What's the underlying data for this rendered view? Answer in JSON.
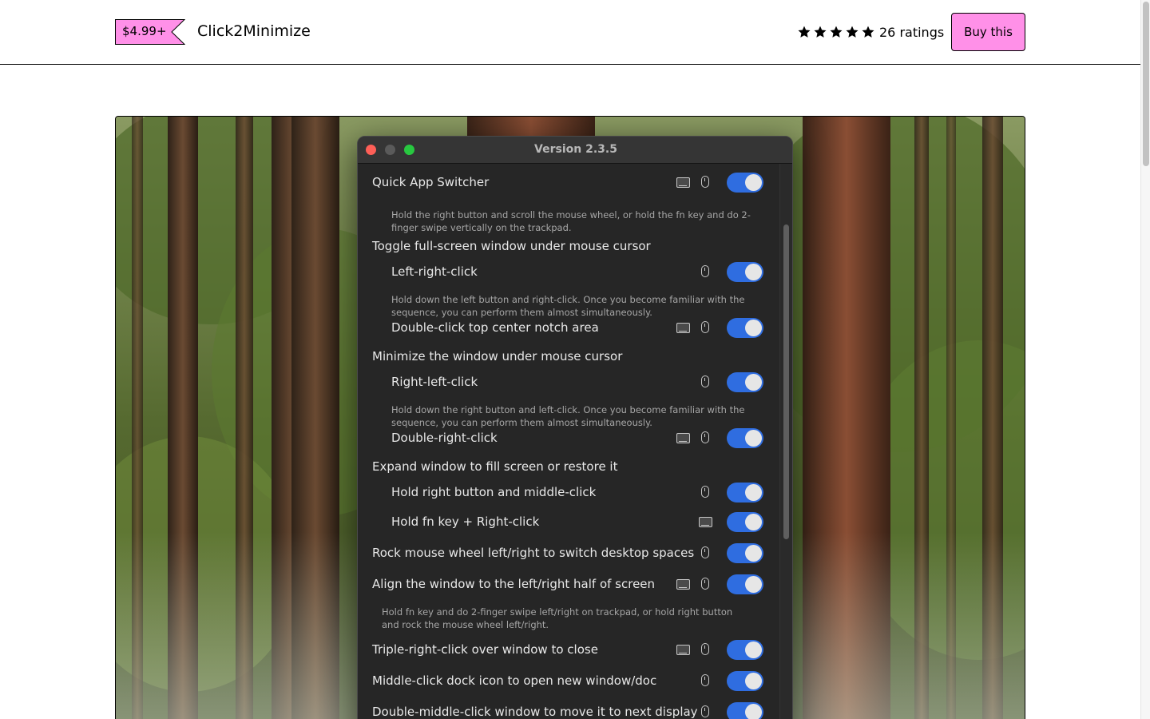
{
  "header": {
    "price": "$4.99+",
    "product_name": "Click2Minimize",
    "rating_stars": 5,
    "ratings_label": "26 ratings",
    "buy_label": "Buy this"
  },
  "colors": {
    "brand_pink": "#ff90e8",
    "toggle_blue": "#2f6de0"
  },
  "app_window": {
    "title": "Version 2.3.5",
    "rows": [
      {
        "type": "setting",
        "label": "Quick App Switcher",
        "icons": [
          "trackpad-icon",
          "mouse-icon"
        ],
        "enabled": true
      },
      {
        "type": "description",
        "text": "Hold the right button and scroll the mouse wheel, or hold the fn key and do 2-finger swipe vertically on the trackpad."
      },
      {
        "type": "heading",
        "label": "Toggle full-screen window under mouse cursor"
      },
      {
        "type": "setting",
        "label": "Left-right-click",
        "icons": [
          "mouse-icon"
        ],
        "enabled": true
      },
      {
        "type": "description",
        "text": "Hold down the left button and right-click. Once you become familiar with the sequence, you can perform them almost simultaneously."
      },
      {
        "type": "setting",
        "label": "Double-click top center notch area",
        "icons": [
          "trackpad-icon",
          "mouse-icon"
        ],
        "enabled": true
      },
      {
        "type": "heading",
        "label": "Minimize the window under mouse cursor"
      },
      {
        "type": "setting",
        "label": "Right-left-click",
        "icons": [
          "mouse-icon"
        ],
        "enabled": true
      },
      {
        "type": "description",
        "text": "Hold down the right button and left-click. Once you become familiar with the sequence, you can perform them almost simultaneously."
      },
      {
        "type": "setting",
        "label": "Double-right-click",
        "icons": [
          "trackpad-icon",
          "mouse-icon"
        ],
        "enabled": true
      },
      {
        "type": "heading",
        "label": "Expand window to fill screen or restore it"
      },
      {
        "type": "setting",
        "label": "Hold right button and middle-click",
        "icons": [
          "mouse-icon"
        ],
        "enabled": true
      },
      {
        "type": "setting",
        "label": "Hold fn key + Right-click",
        "icons": [
          "trackpad-icon"
        ],
        "enabled": true
      },
      {
        "type": "setting",
        "label": "Rock mouse wheel left/right to switch desktop spaces",
        "icons": [
          "mouse-icon"
        ],
        "enabled": true
      },
      {
        "type": "setting",
        "label": "Align the window to the left/right half of screen",
        "icons": [
          "trackpad-icon",
          "mouse-icon"
        ],
        "enabled": true
      },
      {
        "type": "description",
        "text": "Hold fn key and do 2-finger swipe left/right on trackpad, or hold right button and rock the mouse wheel left/right."
      },
      {
        "type": "setting",
        "label": "Triple-right-click over window to close",
        "icons": [
          "trackpad-icon",
          "mouse-icon"
        ],
        "enabled": true
      },
      {
        "type": "setting",
        "label": "Middle-click dock icon to open new window/doc",
        "icons": [
          "mouse-icon"
        ],
        "enabled": true
      },
      {
        "type": "setting",
        "label": "Double-middle-click window to move it to next display",
        "icons": [
          "mouse-icon"
        ],
        "enabled": true
      }
    ]
  }
}
